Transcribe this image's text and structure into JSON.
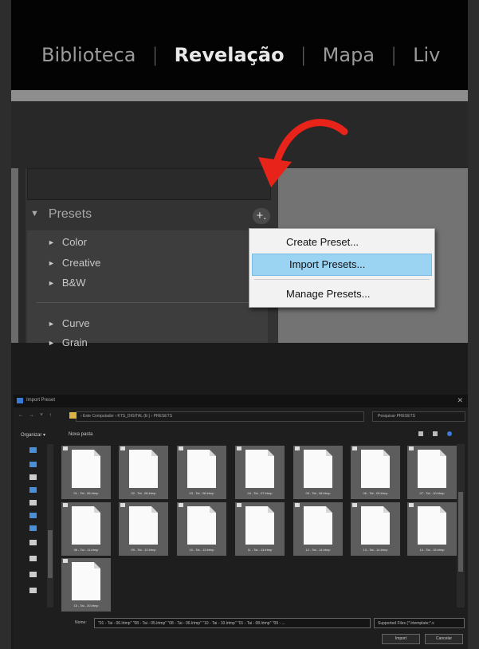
{
  "nav": {
    "items": [
      "Biblioteca",
      "Revelação",
      "Mapa",
      "Liv"
    ],
    "separator": "|"
  },
  "presets_panel": {
    "header": "Presets",
    "collapse_glyph": "▼",
    "expand_glyph": "►",
    "add_button": "+.",
    "items": [
      "Color",
      "Creative",
      "B&W",
      "Curve",
      "Grain"
    ]
  },
  "context_menu": {
    "items": [
      "Create Preset...",
      "Import Presets...",
      "Manage Presets..."
    ],
    "highlighted": "Import Presets..."
  },
  "arrow": {
    "color": "#e8231a"
  },
  "import_dialog": {
    "title": "Import Preset",
    "close": "✕",
    "nav_buttons": "← → ˅ ↑",
    "address_path": "›  Este Computador  ›  KTS_DIGITAL (E:)  ›  PRESETS",
    "search_placeholder": "Pesquisar PRESETS",
    "organize_label": "Organizar ▾",
    "new_folder_label": "Nova pasta",
    "files": [
      "01 - Tai - 06.lrtmp",
      "02 - Tai - 06.lrtmp",
      "03 - Tai - 06.lrtmp",
      "04 - Tai - 07.lrtmp",
      "05 - Tai - 08.lrtmp",
      "06 - Tai - 09.lrtmp",
      "07 - Tai - 10.lrtmp",
      "08 - Tai - 11.lrtmp",
      "09 - Tai - 12.lrtmp",
      "10 - Tai - 13.lrtmp",
      "11 - Tai - 14.lrtmp",
      "12 - Tai - 14.lrtmp",
      "13 - Tai - 14.lrtmp",
      "14 - Tai - 15.lrtmp",
      "15 - Tai - 20.lrtmp"
    ],
    "name_label": "Nome:",
    "name_value": "\"01 - Tai - 06.lrtmp\" \"08 - Tai - 05.lrtmp\" \"08 - Tai - 06.lrtmp\" \"10 - Tai - 10.lrtmp\" \"01 - Tai - 08.lrtmp\" \"09 - ...",
    "filter_value": "Supported Files (*.lrtemplate;*.x",
    "import_button": "Import",
    "cancel_button": "Cancelar"
  }
}
